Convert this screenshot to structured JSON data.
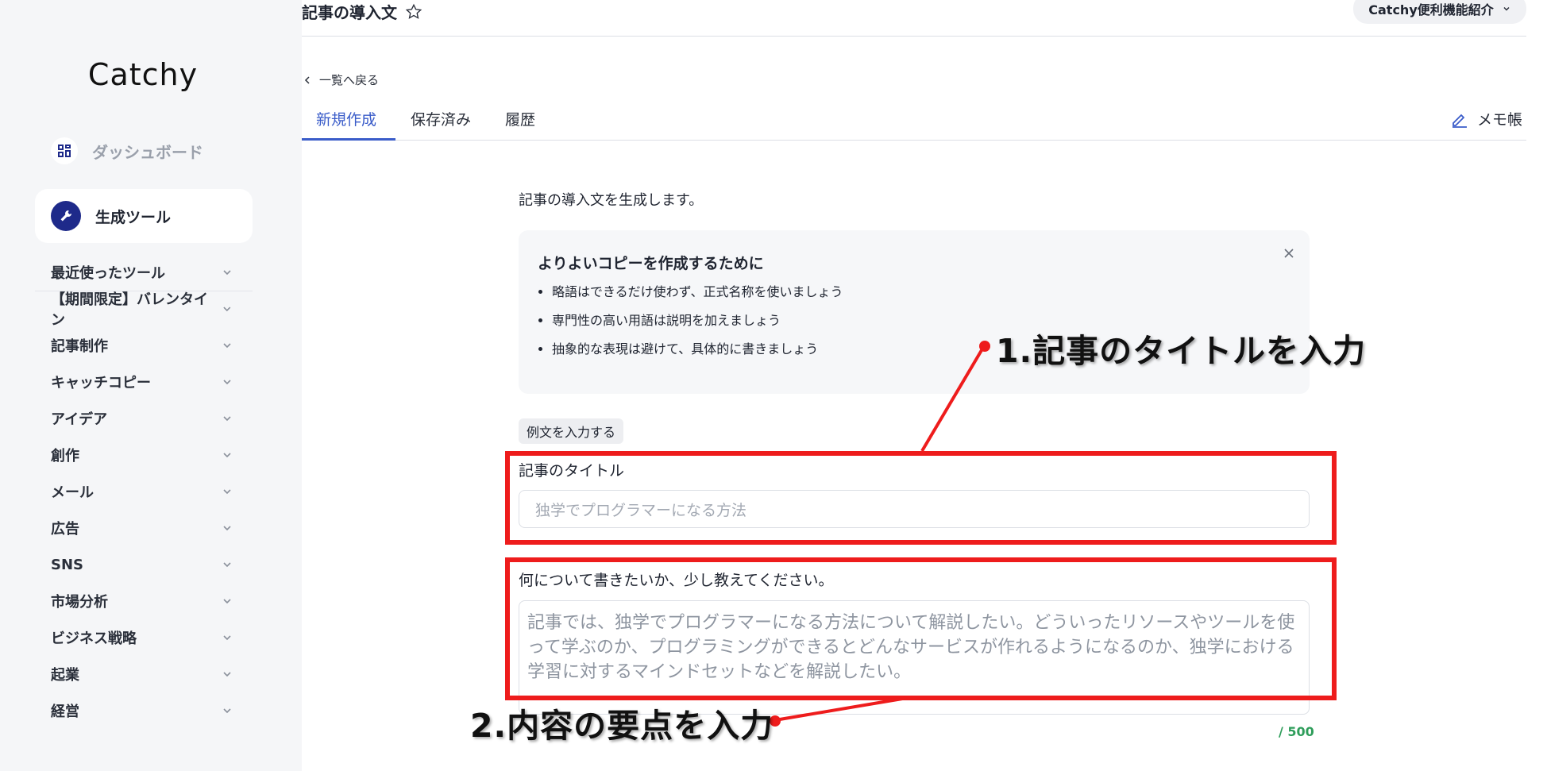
{
  "header": {
    "title": "記事の導入文",
    "feature_button": "Catchy便利機能紹介"
  },
  "sidebar": {
    "logo": "Catchy",
    "dashboard": "ダッシュボード",
    "generation_tools": "生成ツール",
    "categories": [
      "最近使ったツール",
      "【期間限定】バレンタイン",
      "記事制作",
      "キャッチコピー",
      "アイデア",
      "創作",
      "メール",
      "広告",
      "SNS",
      "市場分析",
      "ビジネス戦略",
      "起業",
      "経営"
    ]
  },
  "main": {
    "back_link": "一覧へ戻る",
    "tabs": [
      "新規作成",
      "保存済み",
      "履歴"
    ],
    "memo": "メモ帳",
    "intro": "記事の導入文を生成します。",
    "tips": {
      "title": "よりよいコピーを作成するために",
      "items": [
        "略語はできるだけ使わず、正式名称を使いましょう",
        "専門性の高い用語は説明を加えましょう",
        "抽象的な表現は避けて、具体的に書きましょう"
      ]
    },
    "example_button": "例文を入力する",
    "title_field": {
      "label": "記事のタイトル",
      "placeholder": "独学でプログラマーになる方法"
    },
    "content_field": {
      "label": "何について書きたいか、少し教えてください。",
      "placeholder": "記事では、独学でプログラマーになる方法について解説したい。どういったリソースやツールを使って学ぶのか、プログラミングができるとどんなサービスが作れるようになるのか、独学における学習に対するマインドセットなどを解説したい。",
      "counter": "/ 500"
    }
  },
  "annotations": {
    "callout1": "1.記事のタイトルを入力",
    "callout2": "2.内容の要点を入力",
    "highlight_color": "#ee1c1c"
  },
  "colors": {
    "accent": "#3a5cc9",
    "dark_icon_bg": "#1e2a8a",
    "counter": "#2e9d5a"
  }
}
